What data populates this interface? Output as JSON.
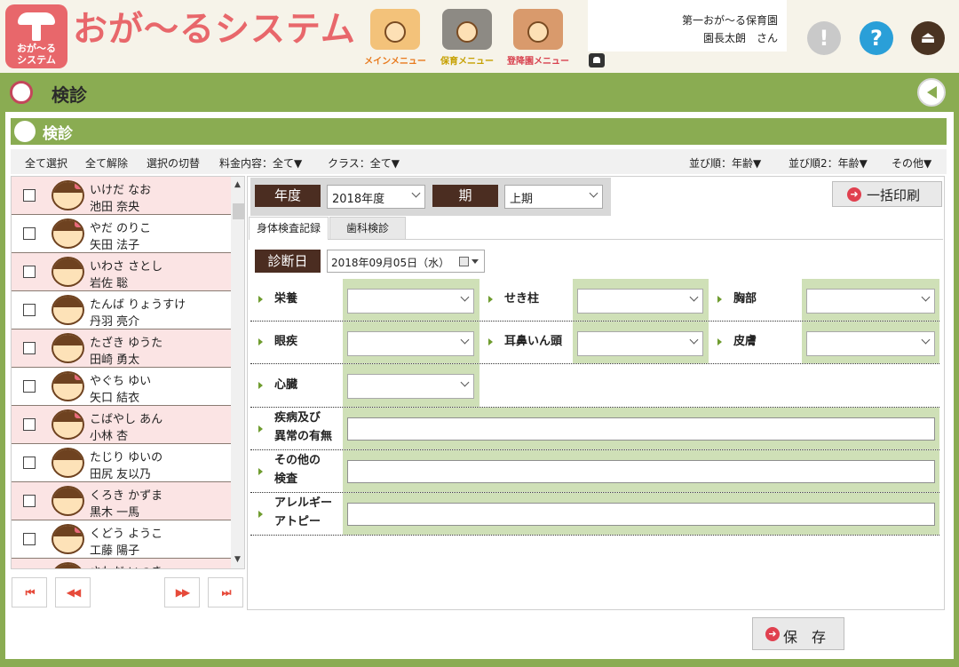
{
  "header": {
    "logo_line1": "おが〜る",
    "logo_line2": "システム",
    "app_title": "おが〜るシステム",
    "menu_main": "メインメニュー",
    "menu_care": "保育メニュー",
    "menu_enroll": "登降園メニュー",
    "facility": "第一おが〜る保育園",
    "user": "園長太朗　さん",
    "alert_glyph": "!",
    "help_glyph": "?",
    "logout_glyph": "⏏"
  },
  "page": {
    "title": "検診",
    "section_title": "検診"
  },
  "toolbar": {
    "select_all": "全て選択",
    "deselect_all": "全て解除",
    "toggle_selection": "選択の切替",
    "fee_filter": "料金内容：全て▼",
    "class_filter": "クラス：全て▼",
    "sort1": "並び順：年齢▼",
    "sort2": "並び順2：年齢▼",
    "other": "その他▼"
  },
  "children": [
    {
      "kana": "いけだ なお",
      "name": "池田 奈央"
    },
    {
      "kana": "やだ のりこ",
      "name": "矢田 法子"
    },
    {
      "kana": "いわさ さとし",
      "name": "岩佐 聡"
    },
    {
      "kana": "たんば りょうすけ",
      "name": "丹羽 亮介"
    },
    {
      "kana": "たざき ゆうた",
      "name": "田崎 勇太"
    },
    {
      "kana": "やぐち ゆい",
      "name": "矢口 結衣"
    },
    {
      "kana": "こばやし あん",
      "name": "小林 杏"
    },
    {
      "kana": "たじり ゆいの",
      "name": "田尻 友以乃"
    },
    {
      "kana": "くろき かずま",
      "name": "黒木 一馬"
    },
    {
      "kana": "くどう ようこ",
      "name": "工藤 陽子"
    },
    {
      "kana": "さわだ いつき",
      "name": ""
    }
  ],
  "pager": {
    "first": "⏮",
    "prev": "◀◀",
    "next": "▶▶",
    "last": "⏭"
  },
  "filters": {
    "year_label": "年度",
    "year_value": "2018年度",
    "term_label": "期",
    "term_value": "上期"
  },
  "bulk_print": "一括印刷",
  "tabs": {
    "body": "身体検査記録",
    "dental": "歯科検診"
  },
  "exam": {
    "date_label": "診断日",
    "date_value": "2018年09月05日（水）",
    "nutrition": "栄養",
    "spine": "せき柱",
    "chest": "胸部",
    "eye_disease": "眼疾",
    "ent": "耳鼻いん頭",
    "skin": "皮膚",
    "heart": "心臓",
    "disease_1": "疾病及び",
    "disease_2": "異常の有無",
    "other_1": "その他の",
    "other_2": "検査",
    "allergy_1": "アレルギー",
    "allergy_2": "アトピー"
  },
  "save": "保　存",
  "colors": {
    "accent_green": "#8aac52",
    "brand_pink": "#e8676b",
    "dark_brown": "#4b2d21",
    "field_green": "#cfe0b7"
  }
}
